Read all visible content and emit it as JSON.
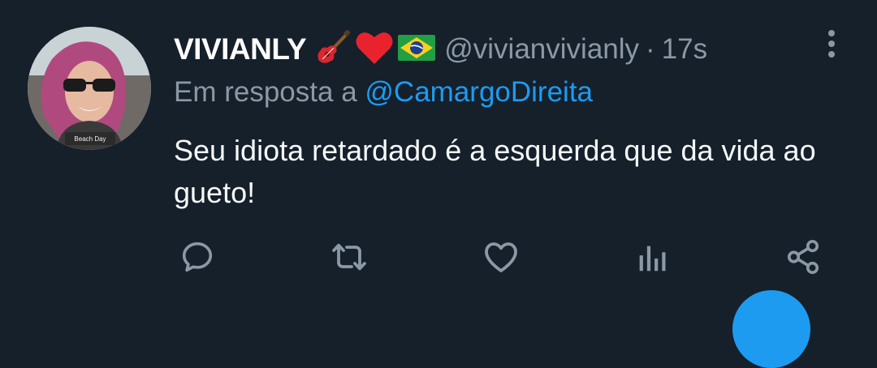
{
  "tweet": {
    "display_name": "VIVIANLY",
    "name_emojis": [
      "guitar-emoji",
      "red-heart-emoji",
      "brazil-flag-emoji"
    ],
    "handle": "@vivianvivianly",
    "separator": "·",
    "time": "17s",
    "reply_prefix": "Em resposta a",
    "reply_to": "@CamargoDireita",
    "text": "Seu idiota retardado é a esquerda que da vida ao gueto!",
    "avatar_caption": "Beach Day"
  },
  "actions": [
    "reply-icon",
    "retweet-icon",
    "like-icon",
    "analytics-icon",
    "share-icon"
  ],
  "colors": {
    "background": "#15202b",
    "primary_text": "#f7f9f9",
    "secondary_text": "#8b98a5",
    "accent": "#1d9bf0"
  }
}
